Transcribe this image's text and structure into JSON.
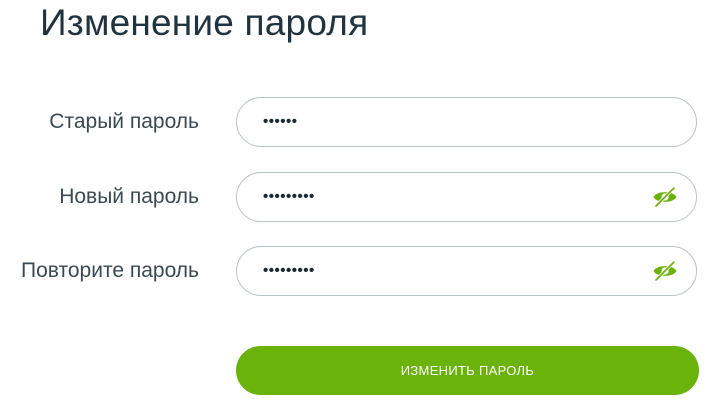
{
  "page": {
    "title": "Изменение пароля"
  },
  "form": {
    "old_password": {
      "label": "Старый пароль",
      "value": "••••••"
    },
    "new_password": {
      "label": "Новый пароль",
      "value": "•••••••••",
      "toggle_icon": "eye-slash-icon"
    },
    "repeat_password": {
      "label": "Повторите пароль",
      "value": "•••••••••",
      "toggle_icon": "eye-slash-icon"
    },
    "submit_label": "ИЗМЕНИТЬ ПАРОЛЬ"
  },
  "colors": {
    "accent": "#6ab30b",
    "icon": "#6ab30b",
    "title": "#1f3440",
    "border": "#b9c3c8"
  }
}
